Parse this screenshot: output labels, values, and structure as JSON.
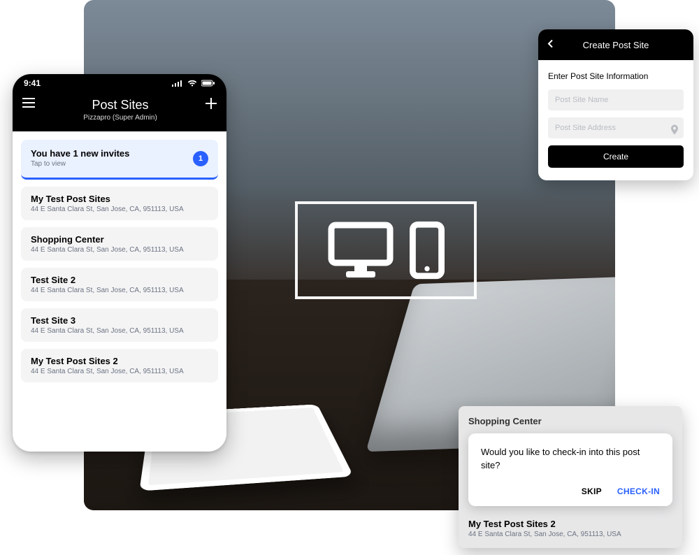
{
  "status_bar": {
    "time": "9:41"
  },
  "phone_header": {
    "title": "Post Sites",
    "subtitle": "Pizzapro (Super Admin)"
  },
  "invites": {
    "title": "You have 1 new invites",
    "subtitle": "Tap to view",
    "count": "1"
  },
  "sites": [
    {
      "name": "My Test Post Sites",
      "address": "44 E Santa Clara St, San Jose, CA, 951113, USA"
    },
    {
      "name": "Shopping Center",
      "address": "44 E Santa Clara St, San Jose, CA, 951113, USA"
    },
    {
      "name": "Test Site 2",
      "address": "44 E Santa Clara St, San Jose, CA, 951113, USA"
    },
    {
      "name": "Test Site 3",
      "address": "44 E Santa Clara St, San Jose, CA, 951113, USA"
    },
    {
      "name": "My Test Post Sites 2",
      "address": "44 E Santa Clara St, San Jose, CA, 951113, USA"
    }
  ],
  "create_panel": {
    "header": "Create Post Site",
    "label": "Enter Post Site Information",
    "name_placeholder": "Post Site Name",
    "address_placeholder": "Post Site Address",
    "button": "Create"
  },
  "checkin": {
    "context_name": "Shopping Center",
    "message": "Would you like to check-in into this post site?",
    "skip": "SKIP",
    "go": "CHECK-IN",
    "below_name": "My Test Post Sites 2",
    "below_address": "44 E Santa Clara St, San Jose, CA, 951113, USA"
  }
}
